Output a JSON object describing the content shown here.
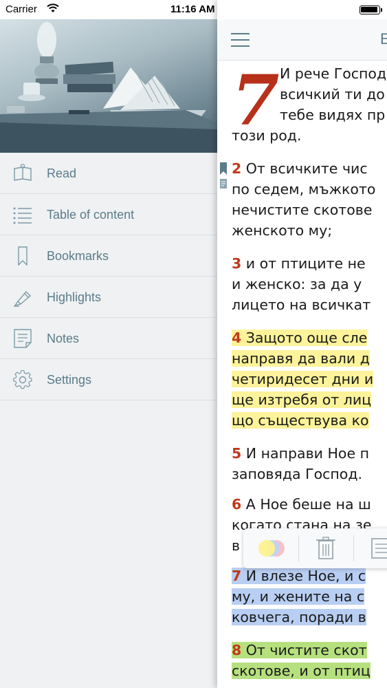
{
  "status_bar": {
    "carrier": "Carrier",
    "time": "11:16 AM"
  },
  "menu": {
    "items": [
      {
        "label": "Read",
        "icon": "book-open-icon"
      },
      {
        "label": "Table of content",
        "icon": "list-icon"
      },
      {
        "label": "Bookmarks",
        "icon": "bookmark-icon"
      },
      {
        "label": "Highlights",
        "icon": "highlighter-icon"
      },
      {
        "label": "Notes",
        "icon": "note-icon"
      },
      {
        "label": "Settings",
        "icon": "gear-icon"
      }
    ]
  },
  "reader": {
    "nav_title": "Б",
    "chapter_number": "7",
    "lines": [
      {
        "num": "",
        "text": "И рече Господ",
        "hl": ""
      },
      {
        "num": "",
        "text": "всичкий ти до",
        "hl": ""
      },
      {
        "num": "",
        "text": "тебе видях пр",
        "hl": ""
      },
      {
        "num": "",
        "text": "този род.",
        "hl": ""
      },
      {
        "num": "2",
        "text": " От всичките чис",
        "hl": ""
      },
      {
        "num": "",
        "text": "по седем, мъжкото",
        "hl": ""
      },
      {
        "num": "",
        "text": "нечистите скотове",
        "hl": ""
      },
      {
        "num": "",
        "text": "женското му;",
        "hl": ""
      },
      {
        "num": "3",
        "text": " и от птиците не",
        "hl": ""
      },
      {
        "num": "",
        "text": "и женско: за да у",
        "hl": ""
      },
      {
        "num": "",
        "text": "лицето на всичкат",
        "hl": ""
      },
      {
        "num": "4",
        "text": " Защото още сле",
        "hl": "yellow"
      },
      {
        "num": "",
        "text": "направя да вали д",
        "hl": "yellow"
      },
      {
        "num": "",
        "text": "четиридесет дни и",
        "hl": "yellow"
      },
      {
        "num": "",
        "text": "ще изтребя от лиц",
        "hl": "yellow"
      },
      {
        "num": "",
        "text": "що съществува ко",
        "hl": "yellow"
      },
      {
        "num": "5",
        "text": " И направи Ное п",
        "hl": ""
      },
      {
        "num": "",
        "text": "заповяда Господ.",
        "hl": ""
      },
      {
        "num": "6",
        "text": " А Ное беше на ш",
        "hl": ""
      },
      {
        "num": "",
        "text": "когато стана на зе",
        "hl": ""
      },
      {
        "num": "",
        "text": "в",
        "hl": ""
      },
      {
        "num": "7",
        "text": " И влезе Ное, и с",
        "hl": "blue"
      },
      {
        "num": "",
        "text": "му, и жените на с",
        "hl": "blue"
      },
      {
        "num": "",
        "text": "ковчега, поради в",
        "hl": "blue"
      },
      {
        "num": "8",
        "text": " От чистите скот",
        "hl": "green"
      },
      {
        "num": "",
        "text": "скотове, и от птиц",
        "hl": "green"
      }
    ]
  },
  "popup": {
    "buttons": [
      "color-picker-icon",
      "trash-icon",
      "note-icon"
    ]
  },
  "colors": {
    "accent": "#5a7b88",
    "verse_number": "#c0391b",
    "highlight_yellow": "#fcf39a",
    "highlight_blue": "#b8cef2",
    "highlight_green": "#b6e07e"
  }
}
